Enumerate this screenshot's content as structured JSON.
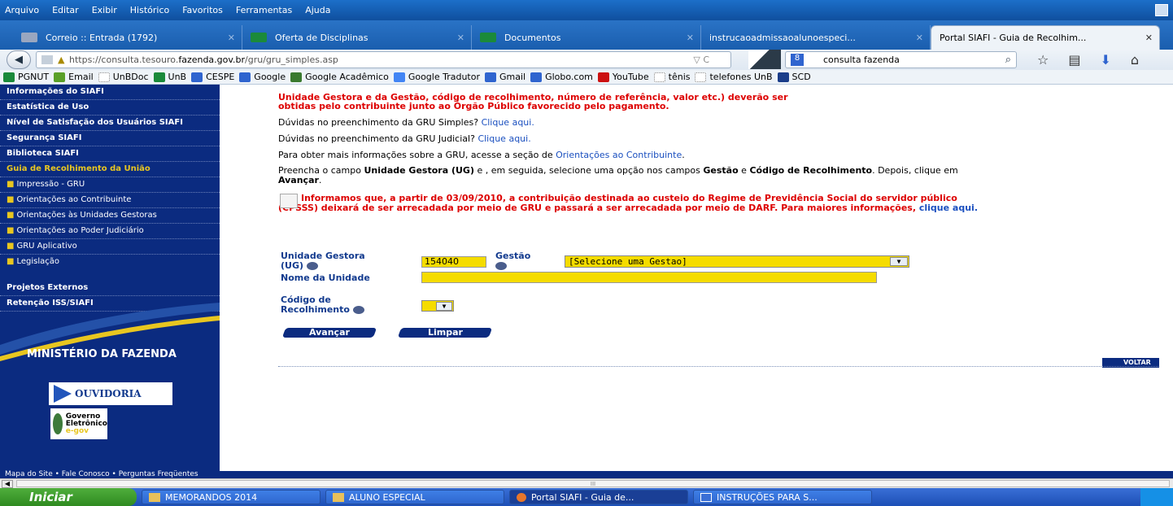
{
  "browser": {
    "menu": [
      "Arquivo",
      "Editar",
      "Exibir",
      "Histórico",
      "Favoritos",
      "Ferramentas",
      "Ajuda"
    ],
    "tabs": [
      {
        "label": "Correio :: Entrada (1792)",
        "color": "#9aa7c0"
      },
      {
        "label": "Oferta de Disciplinas",
        "color": "#1b8a3a"
      },
      {
        "label": "Documentos",
        "color": "#1b8a3a"
      },
      {
        "label": "instrucaoadmissaoalunoespeci...",
        "color": "#c7d3e4"
      },
      {
        "label": "Portal SIAFI - Guia de Recolhim...",
        "color": "#eef3f8",
        "active": true
      }
    ],
    "url_prefix": "https://consulta.tesouro.",
    "url_domain": "fazenda.gov.br",
    "url_path": "/gru/gru_simples.asp",
    "search_value": "consulta fazenda",
    "bookmarks": [
      {
        "label": "PGNUT",
        "color": "#1b8a3a"
      },
      {
        "label": "Email",
        "color": "#5aa028"
      },
      {
        "label": "UnBDoc",
        "color": "#bbbbbb"
      },
      {
        "label": "UnB",
        "color": "#1b8a3a"
      },
      {
        "label": "CESPE",
        "color": "#2f64cf"
      },
      {
        "label": "Google",
        "color": "#2f64cf"
      },
      {
        "label": "Google Acadêmico",
        "color": "#3a7a2f"
      },
      {
        "label": "Google Tradutor",
        "color": "#4285f4"
      },
      {
        "label": "Gmail",
        "color": "#2f64cf"
      },
      {
        "label": "Globo.com",
        "color": "#2f64cf"
      },
      {
        "label": "YouTube",
        "color": "#cc1111"
      },
      {
        "label": "tênis",
        "color": "#bbbbbb"
      },
      {
        "label": "telefones UnB",
        "color": "#bbbbbb"
      },
      {
        "label": "SCD",
        "color": "#1b3d8a"
      }
    ]
  },
  "sidebar": {
    "items": [
      {
        "label": "Informações do SIAFI",
        "type": "main"
      },
      {
        "label": "Estatística de Uso",
        "type": "main"
      },
      {
        "label": "Nível de Satisfação dos Usuários SIAFI",
        "type": "main"
      },
      {
        "label": "Segurança SIAFI",
        "type": "main"
      },
      {
        "label": "Biblioteca SIAFI",
        "type": "main"
      },
      {
        "label": "Guia de Recolhimento da União",
        "type": "gold"
      },
      {
        "label": "Impressão - GRU",
        "type": "sub"
      },
      {
        "label": "Orientações ao Contribuinte",
        "type": "sub"
      },
      {
        "label": "Orientações às Unidades Gestoras",
        "type": "sub"
      },
      {
        "label": "Orientações ao Poder Judiciário",
        "type": "sub"
      },
      {
        "label": "GRU Aplicativo",
        "type": "sub"
      },
      {
        "label": "Legislação",
        "type": "sub"
      }
    ],
    "extra": [
      {
        "label": "Projetos Externos"
      },
      {
        "label": "Retenção ISS/SIAFI"
      }
    ],
    "ministerio": "MINISTÉRIO DA FAZENDA",
    "ouvidoria": "OUVIDORIA",
    "egov_line1": "Governo",
    "egov_line2": "Eletrônico",
    "egov_line3": "e-gov"
  },
  "content": {
    "red_top_1": "Unidade Gestora e da Gestão, código de recolhimento, número de referência, valor etc.) deverão ser",
    "red_top_2": "obtidas pelo contribuinte junto ao Órgão Público favorecido pelo pagamento.",
    "duvidas_simples": "Dúvidas no preenchimento da GRU Simples?",
    "duvidas_judicial": "Dúvidas no preenchimento da GRU Judicial?",
    "clique_aqui": "Clique aqui.",
    "mais_info": "Para obter mais informações sobre a GRU, acesse a seção de",
    "mais_info_link": "Orientações ao Contribuinte",
    "preencha_1": "Preencha o campo",
    "preencha_ug": "Unidade Gestora (UG)",
    "preencha_2": "e , em seguida, selecione uma opção nos campos",
    "preencha_gestao": "Gestão",
    "preencha_e": "e",
    "preencha_codigo": "Código de Recolhimento",
    "preencha_3": ". Depois, clique em",
    "preencha_avancar": "Avançar",
    "notice": "Informamos que, a partir de 03/09/2010, a contribuição destinada ao custeio do Regime de Previdência Social do servidor público (CPSSS) deixará de ser arrecadada por meio de GRU e passará a ser arrecadada por meio de DARF. Para maiores informações,",
    "notice_link": "clique aqui."
  },
  "form": {
    "ug_label_1": "Unidade Gestora",
    "ug_label_2": "(UG)",
    "ug_value": "154040",
    "gestao_label": "Gestão",
    "gestao_value": "[Selecione uma Gestao]",
    "nome_label": "Nome da Unidade",
    "nome_value": "",
    "codigo_label_1": "Código de",
    "codigo_label_2": "Recolhimento",
    "codigo_value": "",
    "avancar": "Avançar",
    "limpar": "Limpar",
    "voltar": "VOLTAR"
  },
  "footer": "Mapa do Site • Fale Conosco • Perguntas Freqüentes",
  "taskbar": {
    "start": "Iniciar",
    "buttons": [
      {
        "label": "MEMORANDOS 2014"
      },
      {
        "label": "ALUNO ESPECIAL"
      },
      {
        "label": "Portal SIAFI - Guia de...",
        "active": true
      },
      {
        "label": "INSTRUÇÕES PARA S..."
      }
    ]
  }
}
